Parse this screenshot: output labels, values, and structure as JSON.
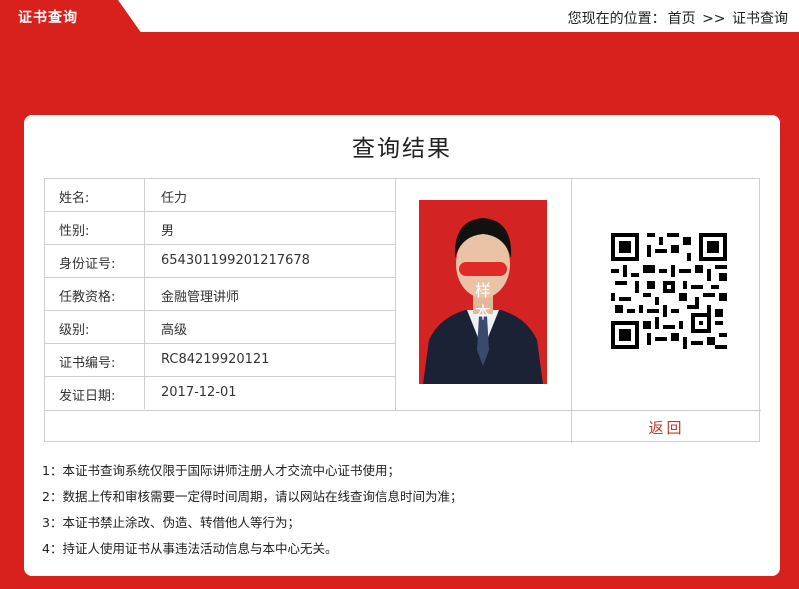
{
  "header": {
    "tab_label": "证书查询",
    "breadcrumb_prefix": "您现在的位置：",
    "breadcrumb_home": "首页",
    "breadcrumb_sep": ">>",
    "breadcrumb_current": "证书查询"
  },
  "result": {
    "title": "查询结果",
    "fields": [
      {
        "label": "姓名:",
        "value": "任力"
      },
      {
        "label": "性别:",
        "value": "男"
      },
      {
        "label": "身份证号:",
        "value": "654301199201217678"
      },
      {
        "label": "任教资格:",
        "value": "金融管理讲师"
      },
      {
        "label": "级别:",
        "value": "高级"
      },
      {
        "label": "证书编号:",
        "value": "RC84219920121"
      },
      {
        "label": "发证日期:",
        "value": "2017-12-01"
      }
    ],
    "photo_stamp_line1": "样",
    "photo_stamp_line2": "本",
    "back_label": "返回"
  },
  "notes": [
    "1：本证书查询系统仅限于国际讲师注册人才交流中心证书使用；",
    "2：数据上传和审核需要一定得时间周期，请以网站在线查询信息时间为准；",
    "3：本证书禁止涂改、伪造、转借他人等行为；",
    "4：持证人使用证书从事违法活动信息与本中心无关。"
  ],
  "colors": {
    "brand_red": "#d8201c",
    "link_red": "#c0392b"
  }
}
